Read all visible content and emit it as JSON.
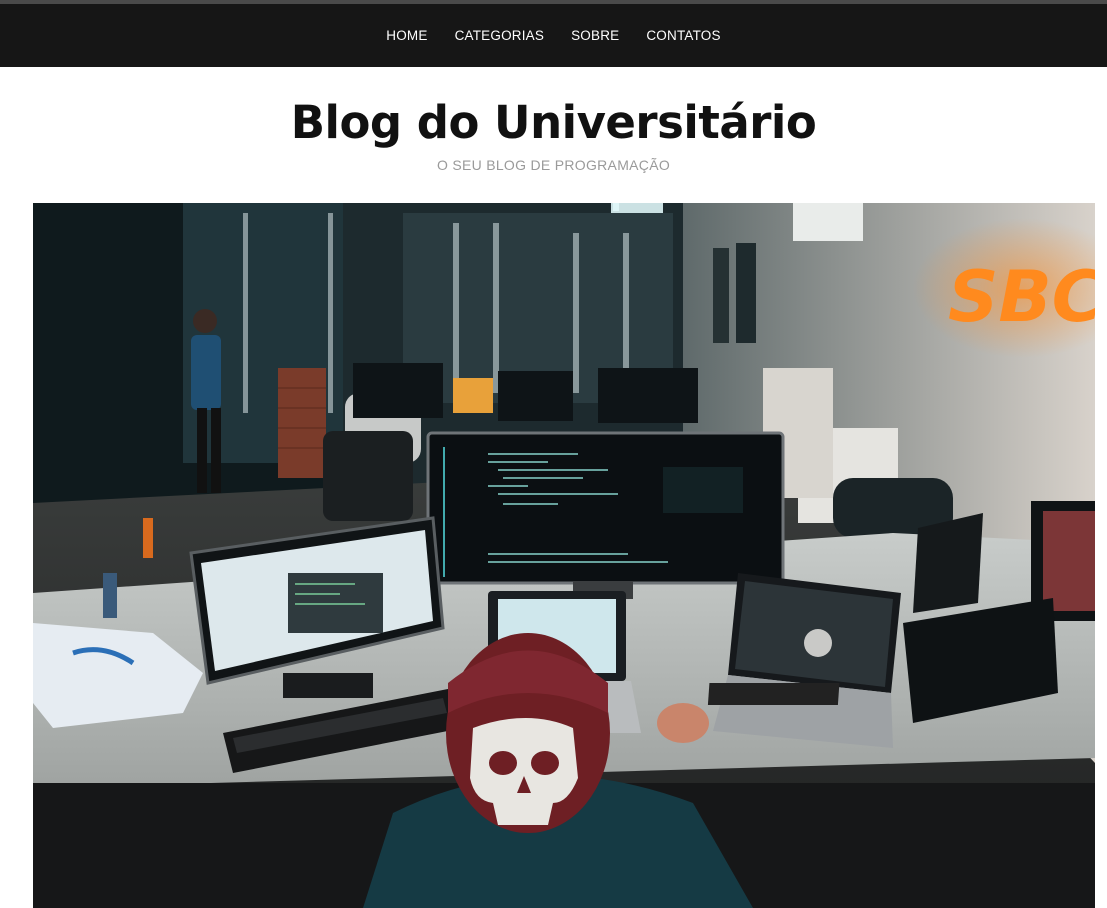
{
  "nav": {
    "items": [
      {
        "label": "HOME"
      },
      {
        "label": "CATEGORIAS"
      },
      {
        "label": "SOBRE"
      },
      {
        "label": "CONTATOS"
      }
    ]
  },
  "header": {
    "title": "Blog do Universitário",
    "subtitle": "O SEU BLOG DE PROGRAMAÇÃO"
  },
  "hero": {
    "sign_text": "SBC"
  },
  "colors": {
    "navbar_bg": "#161616",
    "title": "#111111",
    "subtitle": "#9a9a9a",
    "neon_sign": "#ff8a1e"
  }
}
